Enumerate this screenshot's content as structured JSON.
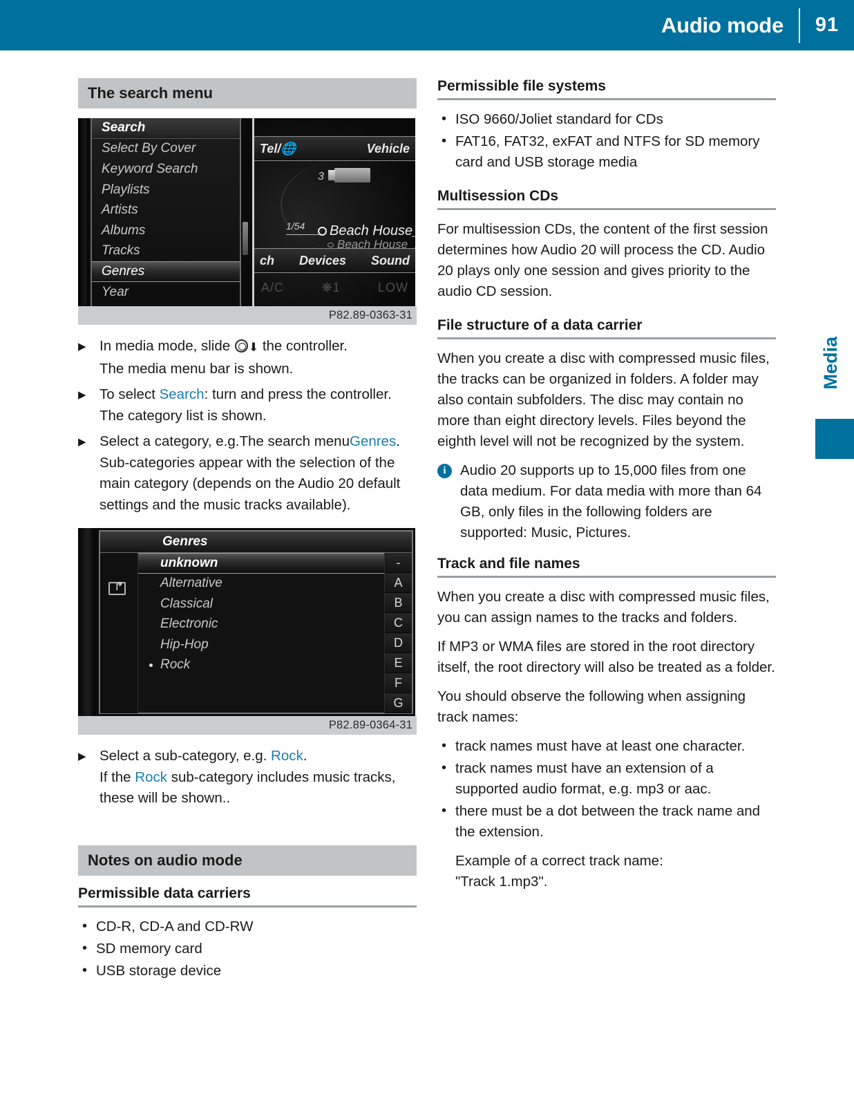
{
  "header": {
    "title": "Audio mode",
    "page_number": "91"
  },
  "side_tab": {
    "label": "Media"
  },
  "left_column": {
    "band_search": "The search menu",
    "figure1": {
      "caption": "P82.89-0363-31",
      "menu_header": "Search",
      "menu_items": [
        "Select By Cover",
        "Keyword Search",
        "Playlists",
        "Artists",
        "Albums",
        "Tracks",
        "Genres",
        "Year"
      ],
      "selected_item": "Genres",
      "top_bar_left": "Tel/",
      "top_bar_right": "Vehicle",
      "source_number": "3",
      "track_counter": "1/54",
      "track_title": "Beach House_...",
      "track_subtitle": "Beach House_...",
      "bottom_bar_left": "ch",
      "bottom_bar_center": "Devices",
      "bottom_bar_right": "Sound",
      "climate_left": "A/C",
      "climate_fan": "1",
      "climate_right": "LOW"
    },
    "steps": [
      {
        "text_before": "In media mode, slide",
        "text_after": "the controller.",
        "result": "The media menu bar is shown."
      },
      {
        "prefix": "To select",
        "highlight": "Search",
        "suffix": ": turn and press the controller.",
        "result": "The category list is shown."
      },
      {
        "prefix": "Select a category, e.g.The search menu",
        "highlight": "Genres",
        "suffix": ".",
        "result": "Sub-categories appear with the selection of the main category (depends on the Audio 20 default settings and the music tracks available)."
      }
    ],
    "figure2": {
      "caption": "P82.89-0364-31",
      "title": "Genres",
      "items": [
        {
          "label": "unknown",
          "selected": true,
          "marked": false
        },
        {
          "label": "Alternative",
          "selected": false,
          "marked": false
        },
        {
          "label": "Classical",
          "selected": false,
          "marked": false
        },
        {
          "label": "Electronic",
          "selected": false,
          "marked": false
        },
        {
          "label": "Hip-Hop",
          "selected": false,
          "marked": false
        },
        {
          "label": "Rock",
          "selected": false,
          "marked": true
        }
      ],
      "alphabet_index": [
        "-",
        "A",
        "B",
        "C",
        "D",
        "E",
        "F",
        "G"
      ]
    },
    "step_sub": {
      "prefix": "Select a sub-category, e.g.",
      "highlight": "Rock",
      "suffix": ".",
      "result_before": "If the",
      "result_highlight": "Rock",
      "result_after": "sub-category includes music tracks, these will be shown.."
    },
    "band_notes": "Notes on audio mode",
    "subhead_carriers": "Permissible data carriers",
    "carriers": [
      "CD-R, CD-A and CD-RW",
      "SD memory card",
      "USB storage device"
    ]
  },
  "right_column": {
    "subhead_filesystems": "Permissible file systems",
    "filesystems": [
      "ISO 9660/Joliet standard for CDs",
      "FAT16, FAT32, exFAT and NTFS for SD memory card and USB storage media"
    ],
    "subhead_multisession": "Multisession CDs",
    "multisession_text": "For multisession CDs, the content of the first session determines how Audio 20 will process the CD. Audio 20 plays only one session and gives priority to the audio CD session.",
    "subhead_filestructure": "File structure of a data carrier",
    "filestructure_text": "When you create a disc with compressed music files, the tracks can be organized in folders. A folder may also contain subfolders. The disc may contain no more than eight directory levels. Files beyond the eighth level will not be recognized by the system.",
    "note_text": "Audio 20 supports up to 15,000 files from one data medium. For data media with more than 64 GB, only files in the following folders are supported: Music, Pictures.",
    "subhead_tracknames": "Track and file names",
    "tracknames_p1": "When you create a disc with compressed music files, you can assign names to the tracks and folders.",
    "tracknames_p2": "If MP3 or WMA files are stored in the root directory itself, the root directory will also be treated as a folder.",
    "tracknames_p3": "You should observe the following when assigning track names:",
    "tracknames_bullets": [
      "track names must have at least one character.",
      "track names must have an extension of a supported audio format, e.g. mp3 or aac.",
      "there must be a dot between the track name and the extension."
    ],
    "example_line1": "Example of a correct track name:",
    "example_line2": "\"Track 1.mp3\"."
  },
  "colors": {
    "accent_blue": "#00719f",
    "band_gray": "#c0c4c7",
    "caption_gray": "#c9cdd0",
    "link_blue": "#1a7eab"
  }
}
